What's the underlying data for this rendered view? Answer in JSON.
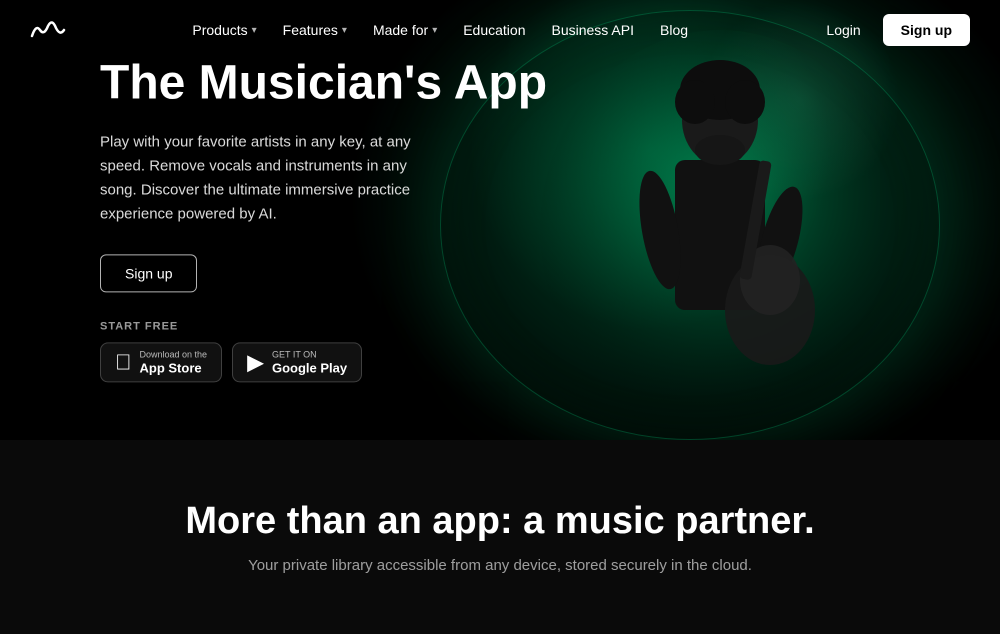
{
  "nav": {
    "logo_alt": "Moises App Logo",
    "links": [
      {
        "label": "Products",
        "has_dropdown": true
      },
      {
        "label": "Features",
        "has_dropdown": true
      },
      {
        "label": "Made for",
        "has_dropdown": true
      },
      {
        "label": "Education",
        "has_dropdown": false
      },
      {
        "label": "Business API",
        "has_dropdown": false
      },
      {
        "label": "Blog",
        "has_dropdown": false
      }
    ],
    "login_label": "Login",
    "signup_label": "Sign up"
  },
  "hero": {
    "title": "The Musician's App",
    "description": "Play with your favorite artists in any key, at any speed. Remove vocals and instruments in any song. Discover the ultimate immersive practice experience powered by AI.",
    "signup_label": "Sign up",
    "start_free_label": "START FREE",
    "app_store": {
      "sub": "Download on the",
      "main": "App Store"
    },
    "google_play": {
      "sub": "GET IT ON",
      "main": "Google Play"
    }
  },
  "bottom": {
    "title": "More than an app: a music partner.",
    "subtitle": "Your private library accessible from any device, stored securely in the cloud."
  }
}
